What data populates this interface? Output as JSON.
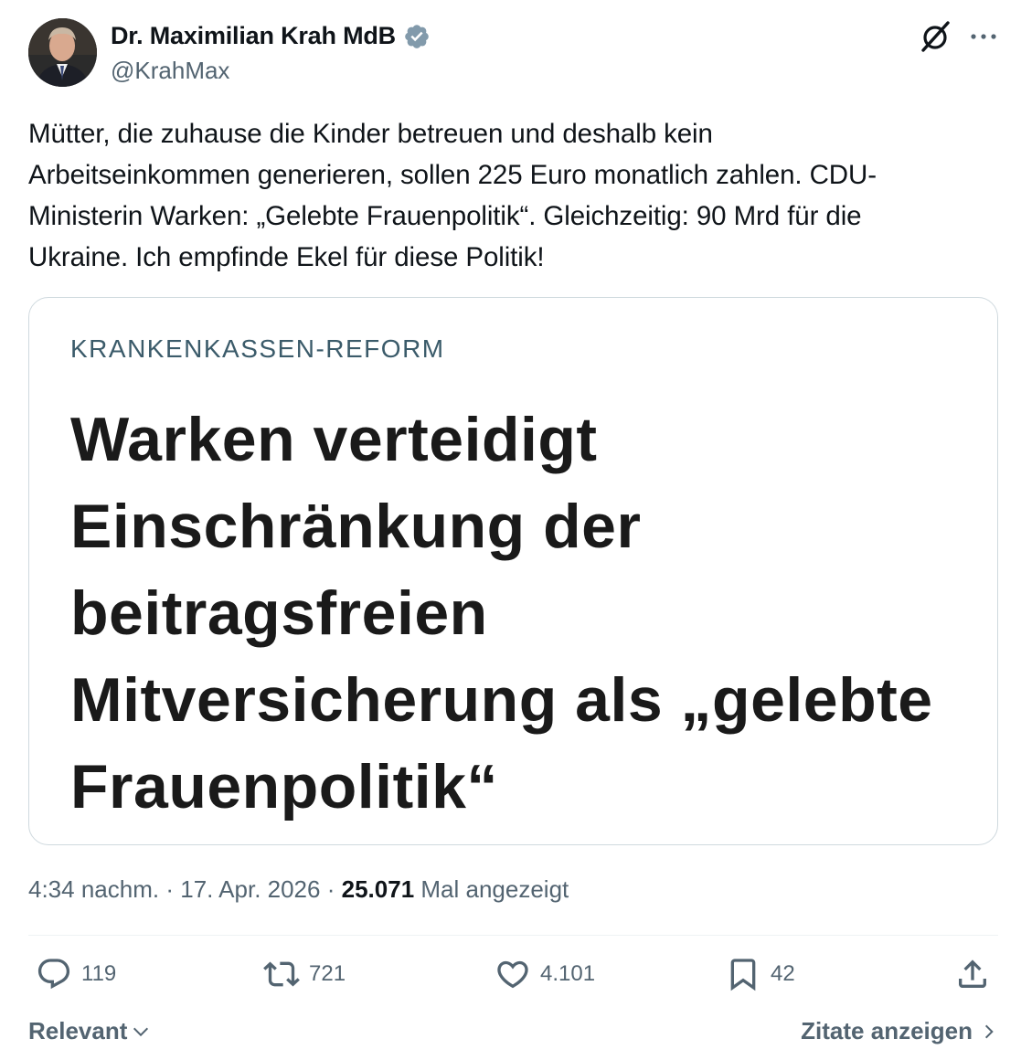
{
  "author": {
    "display_name": "Dr. Maximilian Krah MdB",
    "handle": "@KrahMax",
    "verified": true,
    "verified_color": "#829aab"
  },
  "header_icons": [
    "grok-icon",
    "more-icon"
  ],
  "tweet": {
    "lines": [
      "Mütter, die zuhause die Kinder betreuen und deshalb kein",
      "Arbeitseinkommen generieren, sollen 225 Euro monatlich zahlen. CDU-",
      "Ministerin Warken: „Gelebte Frauenpolitik“. Gleichzeitig: 90 Mrd für die",
      "Ukraine. Ich empfinde Ekel für diese Politik!"
    ]
  },
  "card": {
    "kicker": "KRANKENKASSEN-REFORM",
    "headline_lines": [
      "Warken verteidigt",
      "Einschränkung der",
      "beitragsfreien",
      "Mitversicherung als „gelebte",
      "Frauenpolitik“"
    ]
  },
  "meta": {
    "time": "4:34 nachm.",
    "separator": "·",
    "date": "17. Apr. 2026",
    "views_count": "25.071",
    "views_label": "Mal angezeigt"
  },
  "actions": {
    "replies": "119",
    "reposts": "721",
    "likes": "4.101",
    "bookmarks": "42"
  },
  "footer": {
    "sort_label": "Relevant",
    "quotes_label": "Zitate anzeigen"
  },
  "colors": {
    "text": "#0f1419",
    "secondary": "#536471",
    "border": "#cfd9de",
    "kicker": "#3b5b6a"
  }
}
